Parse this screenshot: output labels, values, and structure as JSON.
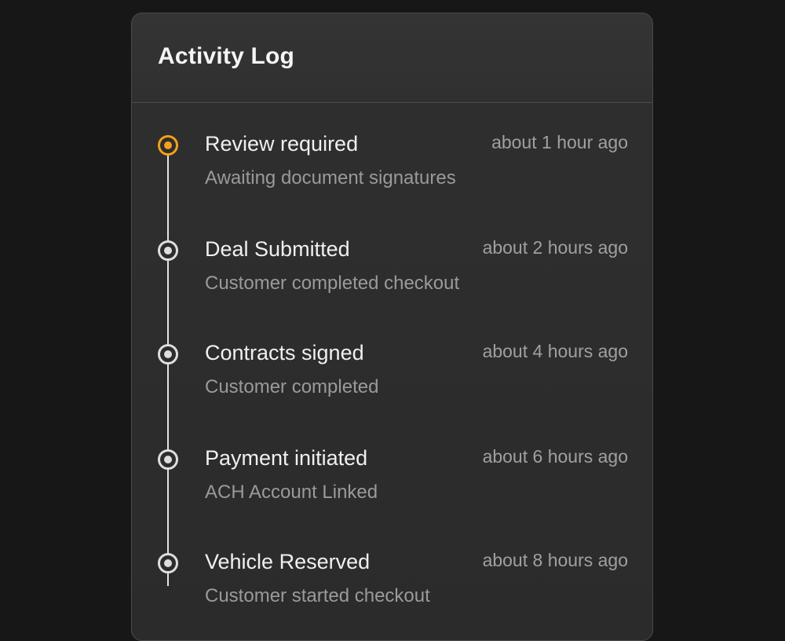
{
  "panel": {
    "title": "Activity Log"
  },
  "activities": [
    {
      "title": "Review required",
      "subtitle": "Awaiting document signatures",
      "time": "about 1 hour ago",
      "status": "active",
      "marker_color": "#f2a11a"
    },
    {
      "title": "Deal Submitted",
      "subtitle": "Customer completed checkout",
      "time": "about 2 hours ago",
      "status": "complete",
      "marker_color": "#dedede"
    },
    {
      "title": "Contracts signed",
      "subtitle": "Customer completed",
      "time": "about 4 hours ago",
      "status": "complete",
      "marker_color": "#dedede"
    },
    {
      "title": "Payment initiated",
      "subtitle": "ACH Account Linked",
      "time": "about 6 hours ago",
      "status": "complete",
      "marker_color": "#dedede"
    },
    {
      "title": "Vehicle Reserved",
      "subtitle": "Customer started checkout",
      "time": "about 8 hours ago",
      "status": "complete",
      "marker_color": "#dedede"
    }
  ]
}
